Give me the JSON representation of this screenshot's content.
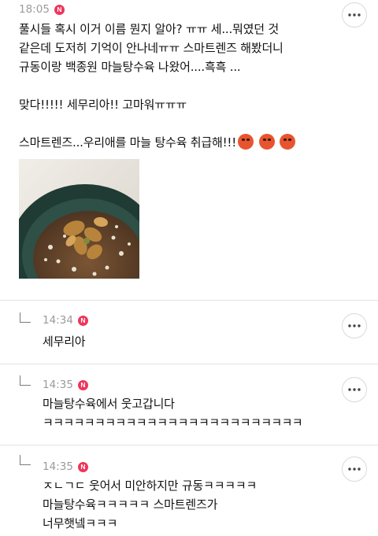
{
  "post": {
    "time": "18:05",
    "badge": "N",
    "lines": [
      "풀시들 혹시 이거 이름 뭔지 알아? ㅠㅠ 세...뭐였던 것",
      "같은데 도저히 기억이 안나네ㅠㅠ 스마트렌즈 해봤더니",
      "규동이랑 백종원 마늘탕수육 나왔어....흑흑 ...",
      "",
      "맞다!!!!! 세무리아!! 고마워ㅠㅠㅠ",
      "",
      "스마트렌즈...우리애를 마늘 탕수육 취급해!!!"
    ],
    "emoji_icons": [
      "angry-face-icon",
      "angry-face-icon",
      "angry-face-icon"
    ],
    "image_icon": "plant-photo"
  },
  "replies": [
    {
      "time": "14:34",
      "badge": "N",
      "lines": [
        "세무리아"
      ]
    },
    {
      "time": "14:35",
      "badge": "N",
      "lines": [
        "마늘탕수육에서 웃고갑니다",
        "ㅋㅋㅋㅋㅋㅋㅋㅋㅋㅋㅋㅋㅋㅋㅋㅋㅋㅋㅋㅋㅋㅋㅋㅋㅋ"
      ]
    },
    {
      "time": "14:35",
      "badge": "N",
      "lines": [
        "ㅈㄴㄱㄷ 웃어서 미안하지만 규동ㅋㅋㅋㅋㅋ",
        "마늘탕수육ㅋㅋㅋㅋㅋ 스마트렌즈가",
        "너무햇넼ㅋㅋㅋ"
      ]
    }
  ],
  "colors": {
    "badge": "#f0345a",
    "meta": "#9a9a9a",
    "divider": "#e3e3e3"
  }
}
